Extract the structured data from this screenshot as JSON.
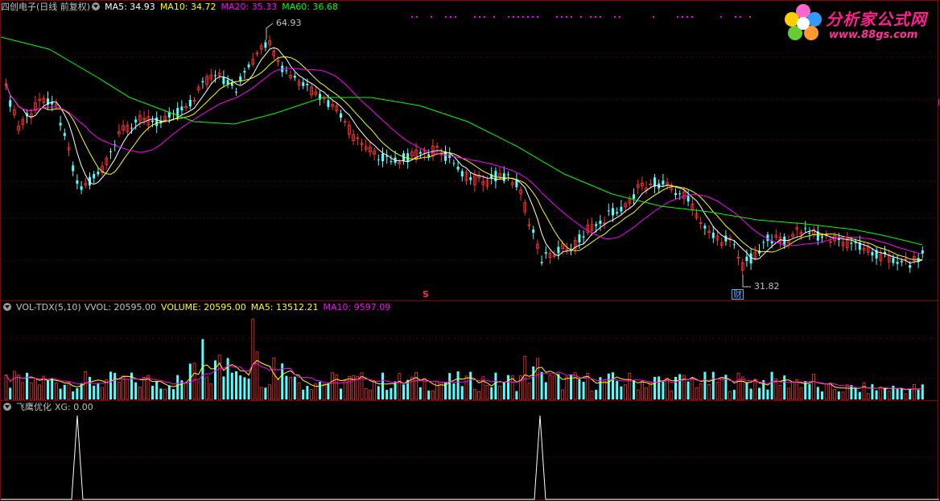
{
  "price_panel": {
    "stock_name": "四创电子(日线 前复权)",
    "ma5": "MA5: 34.93",
    "ma10": "MA10: 34.72",
    "ma20": "MA20: 35.33",
    "ma60": "MA60: 36.68",
    "high_label": "64.93",
    "low_label": "31.82",
    "s_marker": "S",
    "cai_marker": "财"
  },
  "volume_panel": {
    "name": "VOL-TDX(5,10)",
    "vvol": "VVOL: 20595.00",
    "volume": "VOLUME: 20595.00",
    "ma5": "MA5: 13512.21",
    "ma10": "MA10: 9597.09"
  },
  "indicator_panel": {
    "name": "飞鹰优化",
    "xg": "XG: 0.00"
  },
  "logo": {
    "title": "分析家公式网",
    "url": "www.88gs.com"
  },
  "colors": {
    "up": "#ff3232",
    "down": "#54ffff",
    "ma5": "#ffffff",
    "ma10": "#ffff00",
    "ma20": "#ff00ff",
    "ma60": "#00ff00",
    "grid": "#8b0000"
  }
}
